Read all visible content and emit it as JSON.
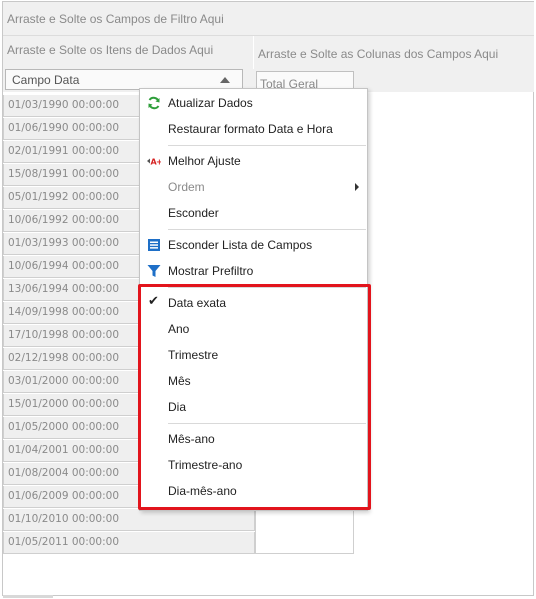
{
  "pivot": {
    "filter_area_hint": "Arraste e Solte os Campos de Filtro Aqui",
    "data_area_hint": "Arraste e Solte os Itens de Dados Aqui",
    "column_area_hint": "Arraste e Solte as Colunas dos Campos Aqui",
    "row_field_label": "Campo Data",
    "total_header": "Total Geral",
    "rows": [
      "01/03/1990 00:00:00",
      "01/06/1990 00:00:00",
      "02/01/1991 00:00:00",
      "15/08/1991 00:00:00",
      "05/01/1992 00:00:00",
      "10/06/1992 00:00:00",
      "01/03/1993 00:00:00",
      "10/06/1994 00:00:00",
      "13/06/1994 00:00:00",
      "14/09/1998 00:00:00",
      "17/10/1998 00:00:00",
      "02/12/1998 00:00:00",
      "03/01/2000 00:00:00",
      "15/01/2000 00:00:00",
      "01/05/2000 00:00:00",
      "01/04/2001 00:00:00",
      "01/08/2004 00:00:00",
      "01/06/2009 00:00:00",
      "01/10/2010 00:00:00",
      "01/05/2011 00:00:00"
    ]
  },
  "menu": {
    "refresh": "Atualizar Dados",
    "restore_format": "Restaurar formato Data e Hora",
    "best_fit": "Melhor Ajuste",
    "order": "Ordem",
    "hide": "Esconder",
    "hide_field_list": "Esconder Lista de Campos",
    "show_prefilter": "Mostrar Prefiltro",
    "date_exact": "Data exata",
    "year": "Ano",
    "quarter": "Trimestre",
    "month": "Mês",
    "day": "Dia",
    "month_year": "Mês-ano",
    "quarter_year": "Trimestre-ano",
    "day_month_year": "Dia-mês-ano"
  },
  "colors": {
    "highlight": "#e2141c",
    "refresh_icon": "#2e9e3a",
    "blue_icon": "#1e6fc7"
  }
}
